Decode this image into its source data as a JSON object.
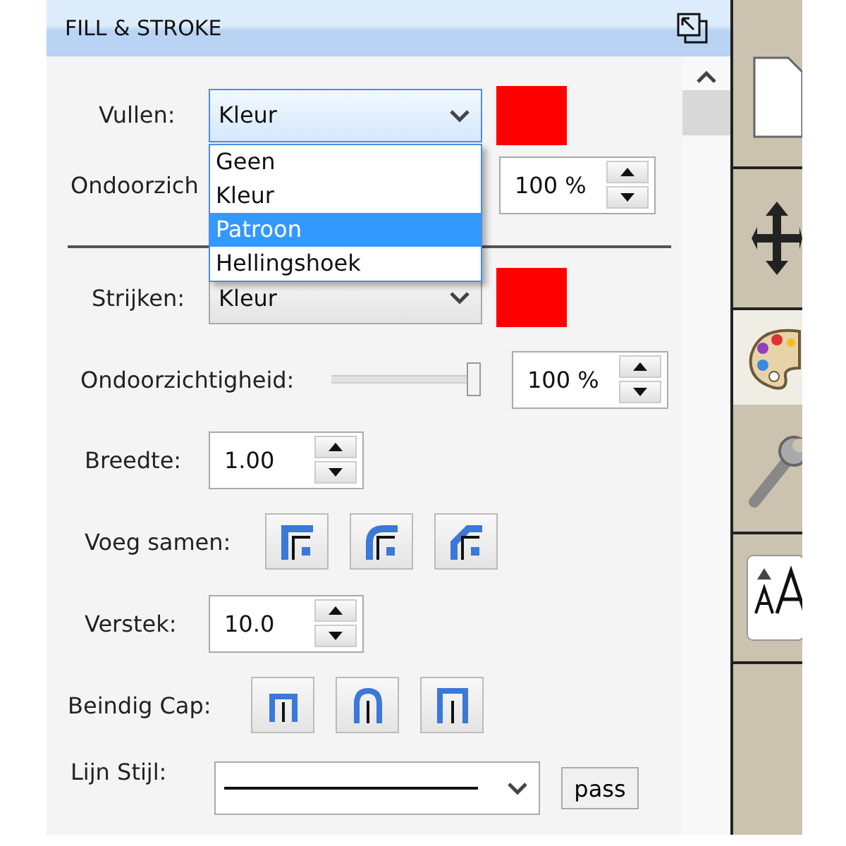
{
  "panel": {
    "title": "FILL & STROKE"
  },
  "fill": {
    "label": "Vullen:",
    "value": "Kleur",
    "color": "#ff0000",
    "menu": [
      {
        "label": "Geen",
        "highlighted": false
      },
      {
        "label": "Kleur",
        "highlighted": false
      },
      {
        "label": "Patroon",
        "highlighted": true
      },
      {
        "label": "Hellingshoek",
        "highlighted": false
      }
    ]
  },
  "fill_opacity": {
    "label": "Ondoorzich",
    "value": "100 %"
  },
  "stroke": {
    "label": "Strijken:",
    "value": "Kleur",
    "color": "#ff0000"
  },
  "stroke_opacity": {
    "label": "Ondoorzichtigheid:",
    "level": 0.95,
    "value": "100 %"
  },
  "width": {
    "label": "Breedte:",
    "value": "1.00"
  },
  "join": {
    "label": "Voeg samen:",
    "buttons": [
      {
        "kind": "miter"
      },
      {
        "kind": "round"
      },
      {
        "kind": "bevel"
      }
    ]
  },
  "miter": {
    "label": "Verstek:",
    "value": "10.0"
  },
  "cap": {
    "label": "Beindig Cap:",
    "buttons": [
      {
        "kind": "butt"
      },
      {
        "kind": "round"
      },
      {
        "kind": "square"
      }
    ]
  },
  "line_style": {
    "label": "Lijn Stijl:",
    "button": "pass"
  },
  "toolbar": [
    {
      "kind": "page",
      "selected": false
    },
    {
      "kind": "move",
      "selected": false
    },
    {
      "kind": "palette",
      "selected": true
    },
    {
      "kind": "wrench",
      "selected": false
    },
    {
      "kind": "text",
      "selected": false
    }
  ]
}
